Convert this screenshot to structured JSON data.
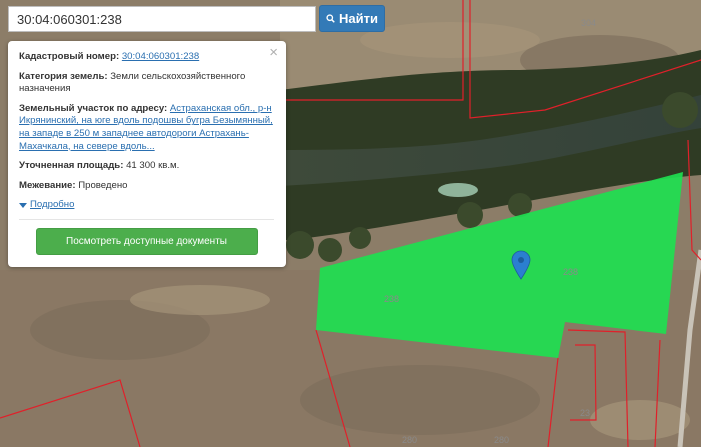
{
  "search": {
    "value": "30:04:060301:238",
    "button_label": "Найти"
  },
  "panel": {
    "cadastral_label": "Кадастровый номер:",
    "cadastral_value": "30:04:060301:238",
    "category_label": "Категория земель:",
    "category_value": "Земли сельскохозяйственного назначения",
    "address_label": "Земельный участок по адресу:",
    "address_value": "Астраханская обл., р-н Икрянинский, на юге вдоль подошвы бугра Безымянный, на западе в 250 м западнее автодороги Астрахань-Махачкала, на севере вдоль...",
    "area_label": "Уточненная площадь:",
    "area_value": "41 300 кв.м.",
    "survey_label": "Межевание:",
    "survey_value": "Проведено",
    "more_label": "Подробно",
    "docs_button": "Посмотреть доступные документы",
    "close_symbol": "×"
  },
  "map": {
    "parcel_labels": [
      "304",
      "238",
      "238",
      "23",
      "280",
      "280"
    ],
    "parcel_color": "#1ee050",
    "boundary_color": "#e0202a"
  }
}
